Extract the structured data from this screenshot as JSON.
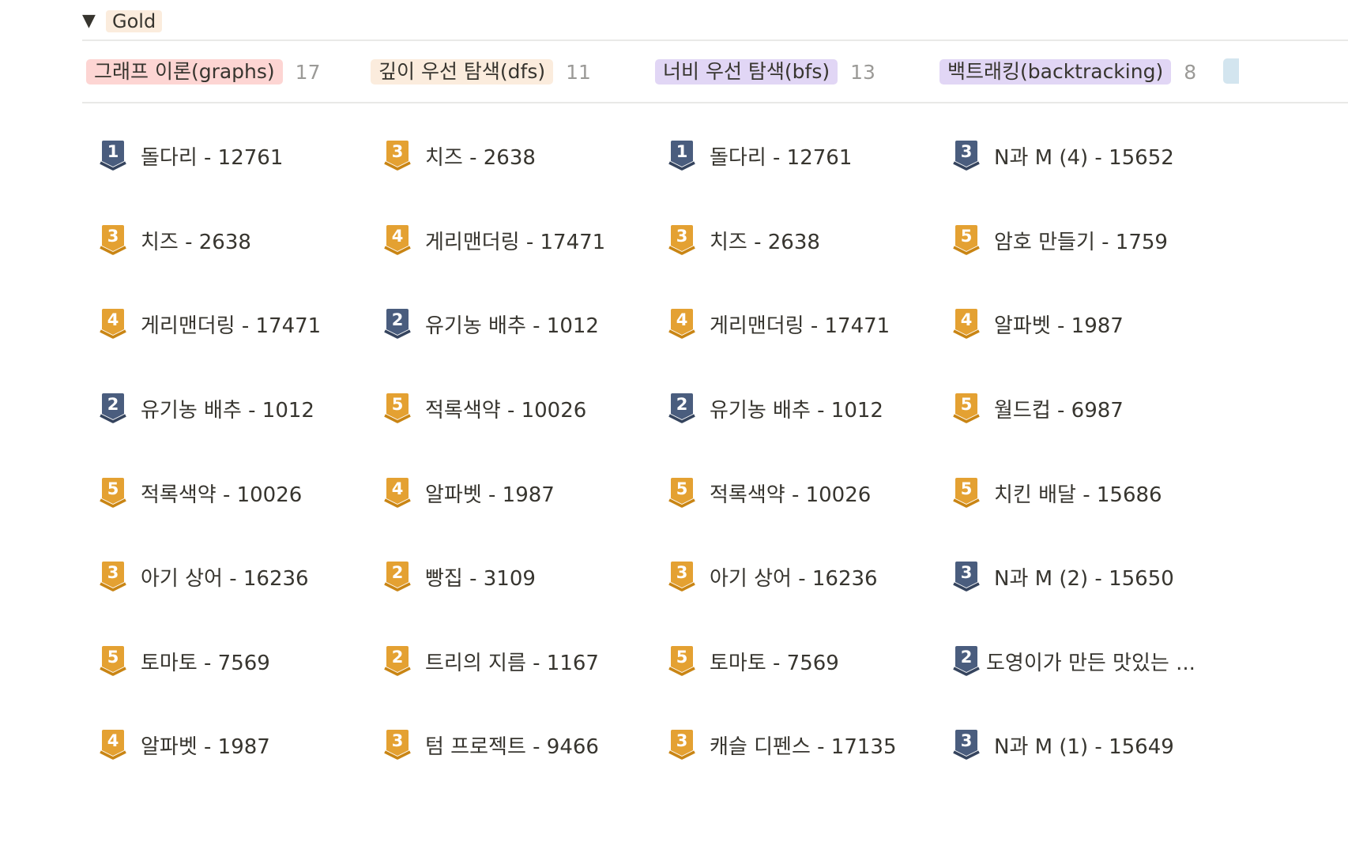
{
  "group": {
    "toggle_glyph": "▼",
    "label": "Gold",
    "label_bg": "#fbecdd"
  },
  "colors": {
    "gold_badge": "#e4a132",
    "gold_badge_dark": "#c98514",
    "silver_badge": "#4a5d7e",
    "silver_badge_dark": "#35445e",
    "divider": "#e9e9e7",
    "count_text": "#9b9a97"
  },
  "columns": [
    {
      "label": "그래프 이론(graphs)",
      "count": "17",
      "tag_bg": "#fdd5d3",
      "cards": [
        {
          "title": "돌다리 - 12761",
          "tier": "1",
          "badge": "silver"
        },
        {
          "title": "치즈 - 2638",
          "tier": "3",
          "badge": "gold"
        },
        {
          "title": "게리맨더링 - 17471",
          "tier": "4",
          "badge": "gold"
        },
        {
          "title": "유기농 배추 - 1012",
          "tier": "2",
          "badge": "silver"
        },
        {
          "title": "적록색약 - 10026",
          "tier": "5",
          "badge": "gold"
        },
        {
          "title": "아기 상어 - 16236",
          "tier": "3",
          "badge": "gold"
        },
        {
          "title": "토마토 - 7569",
          "tier": "5",
          "badge": "gold"
        },
        {
          "title": "알파벳 - 1987",
          "tier": "4",
          "badge": "gold"
        }
      ]
    },
    {
      "label": "깊이 우선 탐색(dfs)",
      "count": "11",
      "tag_bg": "#fbecdd",
      "cards": [
        {
          "title": "치즈 - 2638",
          "tier": "3",
          "badge": "gold"
        },
        {
          "title": "게리맨더링 - 17471",
          "tier": "4",
          "badge": "gold"
        },
        {
          "title": "유기농 배추 - 1012",
          "tier": "2",
          "badge": "silver"
        },
        {
          "title": "적록색약 - 10026",
          "tier": "5",
          "badge": "gold"
        },
        {
          "title": "알파벳 - 1987",
          "tier": "4",
          "badge": "gold"
        },
        {
          "title": "빵집 - 3109",
          "tier": "2",
          "badge": "gold"
        },
        {
          "title": "트리의 지름 - 1167",
          "tier": "2",
          "badge": "gold"
        },
        {
          "title": "텀 프로젝트 - 9466",
          "tier": "3",
          "badge": "gold"
        }
      ]
    },
    {
      "label": "너비 우선 탐색(bfs)",
      "count": "13",
      "tag_bg": "#e1d6f5",
      "cards": [
        {
          "title": "돌다리 - 12761",
          "tier": "1",
          "badge": "silver"
        },
        {
          "title": "치즈 - 2638",
          "tier": "3",
          "badge": "gold"
        },
        {
          "title": "게리맨더링 - 17471",
          "tier": "4",
          "badge": "gold"
        },
        {
          "title": "유기농 배추 - 1012",
          "tier": "2",
          "badge": "silver"
        },
        {
          "title": "적록색약 - 10026",
          "tier": "5",
          "badge": "gold"
        },
        {
          "title": "아기 상어 - 16236",
          "tier": "3",
          "badge": "gold"
        },
        {
          "title": "토마토 - 7569",
          "tier": "5",
          "badge": "gold"
        },
        {
          "title": "캐슬 디펜스 - 17135",
          "tier": "3",
          "badge": "gold"
        }
      ]
    },
    {
      "label": "백트래킹(backtracking)",
      "count": "8",
      "tag_bg": "#e1d6f5",
      "cards": [
        {
          "title": "N과 M (4) - 15652",
          "tier": "3",
          "badge": "silver"
        },
        {
          "title": "암호 만들기 - 1759",
          "tier": "5",
          "badge": "gold"
        },
        {
          "title": "알파벳 - 1987",
          "tier": "4",
          "badge": "gold"
        },
        {
          "title": "월드컵 - 6987",
          "tier": "5",
          "badge": "gold"
        },
        {
          "title": "치킨 배달 - 15686",
          "tier": "5",
          "badge": "gold"
        },
        {
          "title": "N과 M (2) - 15650",
          "tier": "3",
          "badge": "silver"
        },
        {
          "title": "도영이가 만든 맛있는 ...",
          "tier": "2",
          "badge": "silver"
        },
        {
          "title": "N과 M (1) - 15649",
          "tier": "3",
          "badge": "silver"
        }
      ]
    }
  ],
  "edge_tag": {
    "tag_bg": "#d3e5ef"
  }
}
